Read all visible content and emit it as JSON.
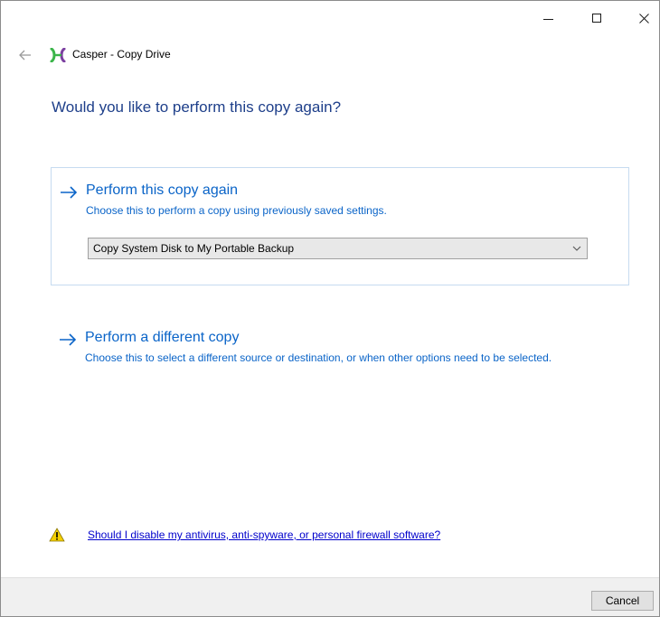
{
  "window": {
    "app_name": "Casper",
    "title_separator": " - ",
    "page_name": "Copy Drive"
  },
  "heading": "Would you like to perform this copy again?",
  "options": [
    {
      "title": "Perform this copy again",
      "description": "Choose this to perform a copy using previously saved settings.",
      "select_value": "Copy System Disk to My Portable Backup"
    },
    {
      "title": "Perform a different copy",
      "description": "Choose this to select a different source or destination, or when other options need to be selected."
    }
  ],
  "help_link": "Should I disable my antivirus, anti-spyware, or personal firewall software?",
  "footer": {
    "cancel_label": "Cancel"
  },
  "icons": {
    "minimize": "minimize-icon",
    "maximize": "maximize-icon",
    "close": "close-icon",
    "back": "back-arrow-icon",
    "logo": "casper-logo-icon",
    "option_arrow": "right-arrow-icon",
    "dropdown": "chevron-down-icon",
    "warning": "warning-icon"
  },
  "colors": {
    "heading": "#1e3f8a",
    "option_text": "#0a64c8",
    "card_border": "#c6dbf0",
    "link": "#0000cc",
    "warning_fill": "#f5d000",
    "logo_green": "#3bb54a",
    "logo_purple": "#7b3fa0"
  }
}
